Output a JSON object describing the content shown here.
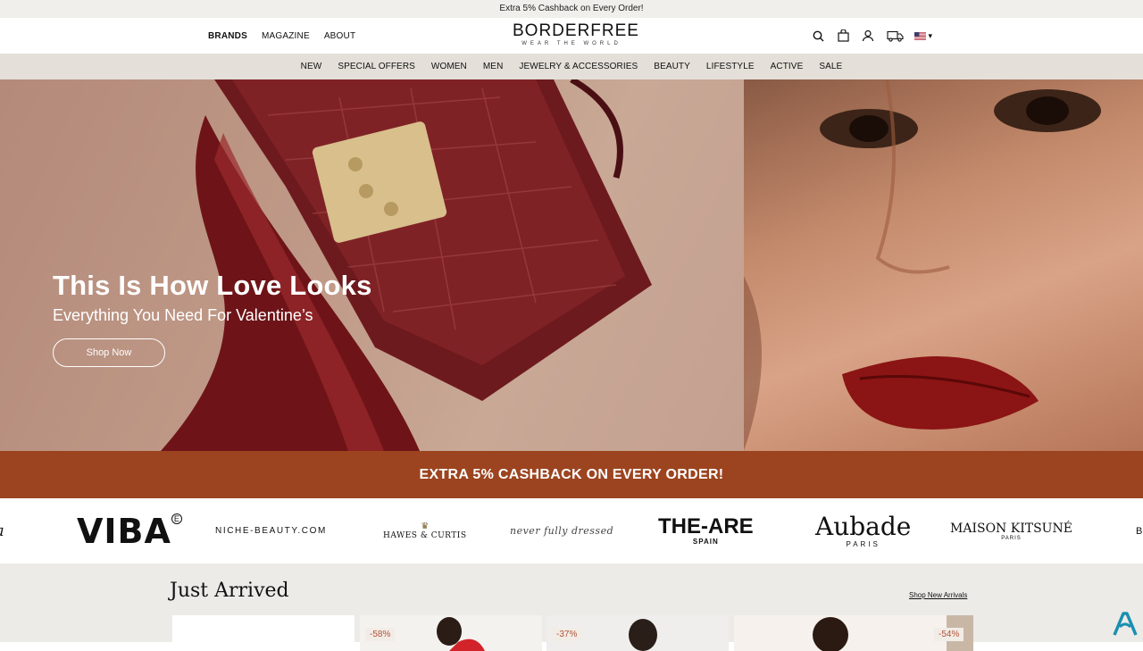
{
  "announcement": "Extra 5% Cashback on Every Order!",
  "header": {
    "nav": [
      "BRANDS",
      "MAGAZINE",
      "ABOUT"
    ],
    "logo_word": "BORDERFREE",
    "logo_tagline": "WEAR THE WORLD",
    "icons": [
      "search-icon",
      "bag-icon",
      "user-icon",
      "truck-icon",
      "us-flag-icon"
    ]
  },
  "categories": [
    "NEW",
    "SPECIAL OFFERS",
    "WOMEN",
    "MEN",
    "JEWELRY & ACCESSORIES",
    "BEAUTY",
    "LIFESTYLE",
    "ACTIVE",
    "SALE"
  ],
  "hero": {
    "title": "This Is How Love Looks",
    "subtitle": "Everything You Need For Valentine’s",
    "cta": "Shop Now"
  },
  "cashback_banner": "EXTRA 5% CASHBACK ON EVERY ORDER!",
  "brands": {
    "viba": "VIBA",
    "niche": "NICHE-BEAUTY.COM",
    "hawes": "HAWES & CURTIS",
    "never": "never fully dressed",
    "theare": "THE-ARE",
    "theare_sub": "SPAIN",
    "aubade": "Aubade",
    "aubade_sub": "PARIS",
    "maison": "MAISON KITSUNÉ",
    "maison_sub": "PARIS"
  },
  "just_arrived": {
    "title": "Just Arrived",
    "link": "Shop New Arrivals",
    "badges": [
      "-58%",
      "-37%",
      "-54%"
    ]
  },
  "colors": {
    "cashback_bg": "#9c4420",
    "catnav_bg": "#e4dfd9",
    "section_bg": "#ecebe8",
    "badge_text": "#b0533a"
  }
}
